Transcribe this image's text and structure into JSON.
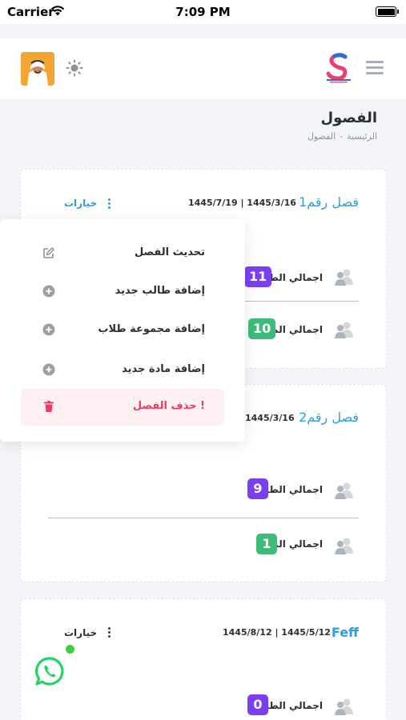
{
  "status_bar": {
    "carrier": "Carrier",
    "time": "7:09 PM"
  },
  "page": {
    "title": "الفصول",
    "breadcrumb_home": "الرئيسية",
    "breadcrumb_separator": "-",
    "breadcrumb_current": "الفصول"
  },
  "cards": [
    {
      "name": "فصل رقم1",
      "dates": "1445/7/19 | 1445/3/16",
      "options_label": "خيارات",
      "students_label": "اجمالي الطلاب",
      "students_count": "11",
      "subjects_label": "اجمالي المواد",
      "subjects_count": "10"
    },
    {
      "name": "فصل رقم2",
      "dates": "1445/3/16",
      "students_label": "اجمالي الطلاب",
      "students_count": "9",
      "subjects_label": "اجمالي المواد",
      "subjects_count": "1"
    },
    {
      "name": "Feff",
      "dates": "1445/8/12 | 1445/5/12",
      "options_label": "خيارات",
      "students_label": "اجمالي الطلاب",
      "students_count": "0"
    }
  ],
  "options_menu": {
    "items": [
      {
        "label": "تحديث الفصل",
        "icon": "edit-icon"
      },
      {
        "label": "إضافة طالب جديد",
        "icon": "plus-circle-icon"
      },
      {
        "label": "إضافة مجموعة طلاب",
        "icon": "plus-circle-icon"
      },
      {
        "label": "إضافة مادة جديد",
        "icon": "plus-circle-icon"
      },
      {
        "label": "حذف الفصل !",
        "icon": "trash-icon"
      }
    ]
  },
  "colors": {
    "accent": "#2b9fdb",
    "purple_badge": "#7a3ff2",
    "green_badge": "#3dbb7a",
    "danger": "#ee3b63",
    "whatsapp": "#25d366"
  }
}
